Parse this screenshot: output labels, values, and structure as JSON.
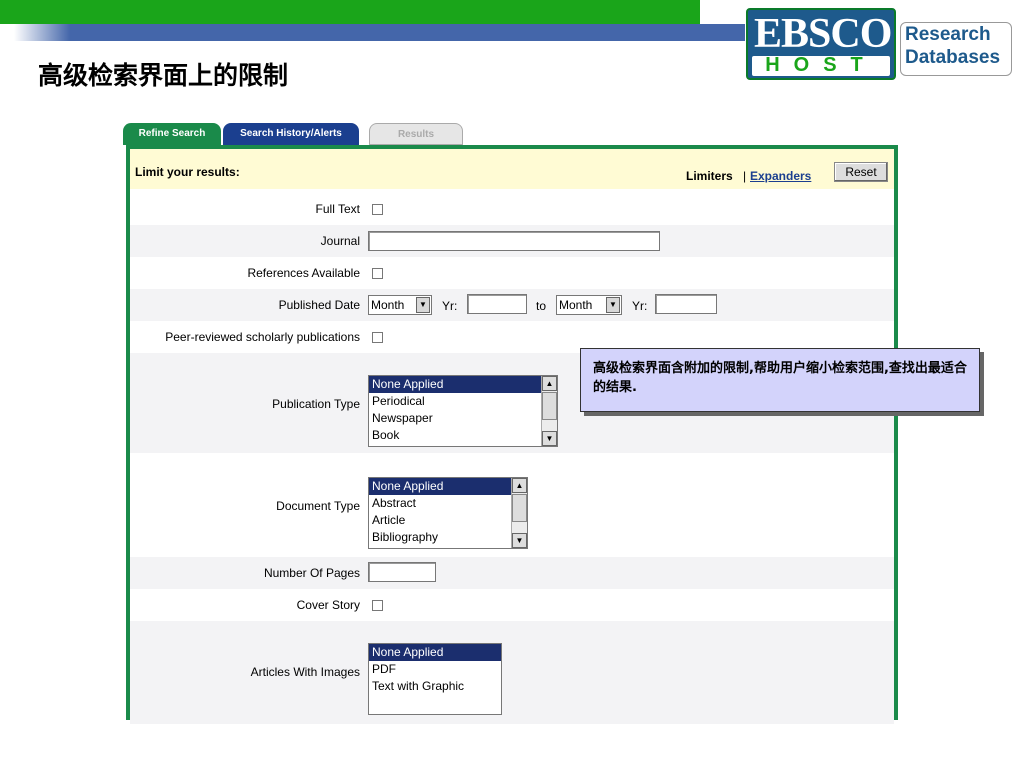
{
  "slide": {
    "title": "高级检索界面上的限制"
  },
  "logo": {
    "ebsco": "EBSCO",
    "host": "HOST",
    "research": "Research",
    "databases": "Databases"
  },
  "tabs": [
    {
      "label": "Refine Search"
    },
    {
      "label": "Search History/Alerts"
    },
    {
      "label": "Results"
    }
  ],
  "panel": {
    "title": "Limit your results:",
    "limiters_label": "Limiters",
    "separator": "|",
    "expanders_link": "Expanders",
    "reset_label": "Reset"
  },
  "fields": {
    "full_text": "Full Text",
    "journal": "Journal",
    "references": "References Available",
    "published_date": "Published Date",
    "month_select": "Month",
    "yr_label": "Yr:",
    "to_label": "to",
    "peer_reviewed": "Peer-reviewed scholarly publications",
    "publication_type": "Publication Type",
    "document_type": "Document Type",
    "number_of_pages": "Number Of Pages",
    "cover_story": "Cover Story",
    "articles_with_images": "Articles With Images"
  },
  "publication_type_options": [
    "None Applied",
    "Periodical",
    "Newspaper",
    "Book"
  ],
  "document_type_options": [
    "None Applied",
    "Abstract",
    "Article",
    "Bibliography"
  ],
  "image_options": [
    "None Applied",
    "PDF",
    "Text with Graphic"
  ],
  "callout": {
    "text": "高级检索界面含附加的限制,帮助用户缩小检索范围,查找出最适合的结果."
  },
  "colors": {
    "green": "#1a8a4a",
    "navy": "#1b3f8f",
    "header_bg": "#fffbd4",
    "callout_bg": "#d3d3fb"
  }
}
